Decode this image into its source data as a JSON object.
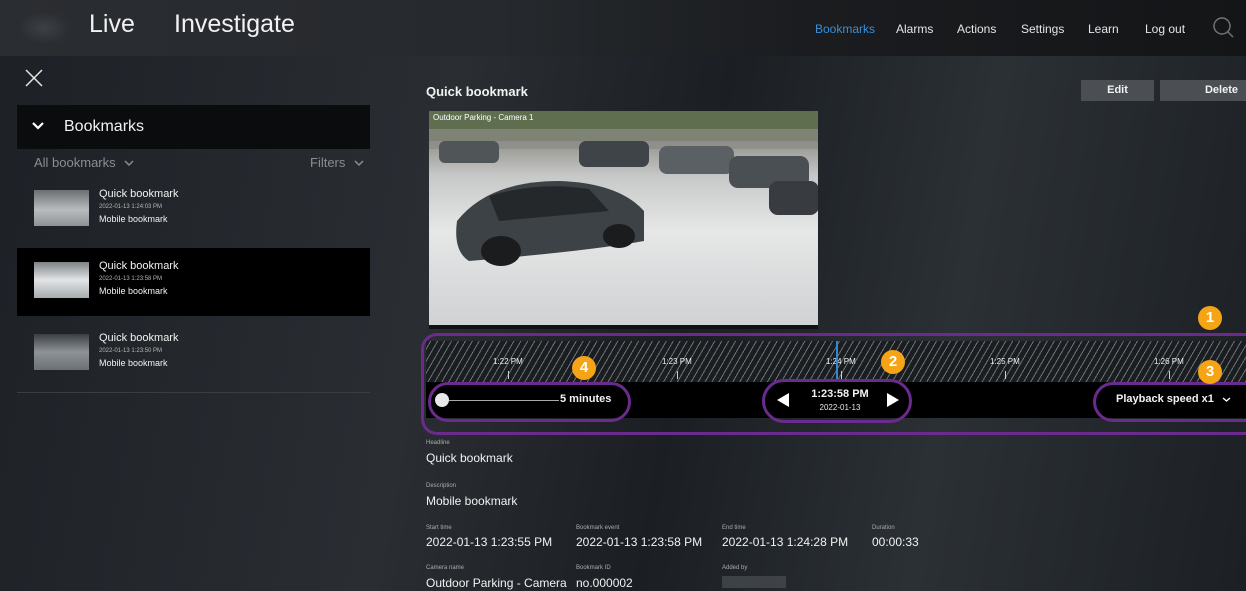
{
  "topbar": {
    "tabs": [
      "Live",
      "Investigate"
    ],
    "nav": [
      "Bookmarks",
      "Alarms",
      "Actions",
      "Settings",
      "Learn",
      "Log out"
    ],
    "active_nav": "Bookmarks"
  },
  "sidebar": {
    "header": "Bookmarks",
    "filter_left": "All bookmarks",
    "filter_right": "Filters",
    "items": [
      {
        "name": "Quick bookmark",
        "date": "2022-01-13 1:24:03 PM",
        "desc": "Mobile bookmark"
      },
      {
        "name": "Quick bookmark",
        "date": "2022-01-13 1:23:58 PM",
        "desc": "Mobile bookmark"
      },
      {
        "name": "Quick bookmark",
        "date": "2022-01-13 1:23:50 PM",
        "desc": "Mobile bookmark"
      }
    ]
  },
  "main": {
    "title": "Quick bookmark",
    "edit_label": "Edit",
    "delete_label": "Delete",
    "video_label": "Outdoor Parking - Camera 1"
  },
  "timeline": {
    "ticks": [
      "1:22 PM",
      "1:23 PM",
      "1:24 PM",
      "1:25 PM",
      "1:26 PM"
    ],
    "zoom_label": "5 minutes",
    "current_time": "1:23:58 PM",
    "current_date": "2022-01-13",
    "playback_speed": "Playback speed x1"
  },
  "callouts": [
    "1",
    "2",
    "3",
    "4"
  ],
  "details": {
    "headline_label": "Headline",
    "headline": "Quick bookmark",
    "description_label": "Description",
    "description": "Mobile bookmark",
    "start_label": "Start time",
    "start": "2022-01-13 1:23:55 PM",
    "event_label": "Bookmark event",
    "event": "2022-01-13 1:23:58 PM",
    "end_label": "End time",
    "end": "2022-01-13 1:24:28 PM",
    "duration_label": "Duration",
    "duration": "00:00:33",
    "camera_label": "Camera name",
    "camera": "Outdoor Parking - Camera",
    "id_label": "Bookmark ID",
    "id": "no.000002",
    "added_label": "Added by"
  },
  "colors": {
    "accent": "#3a8fd8",
    "callout": "#f5a416",
    "outline": "#6b2a8e"
  }
}
